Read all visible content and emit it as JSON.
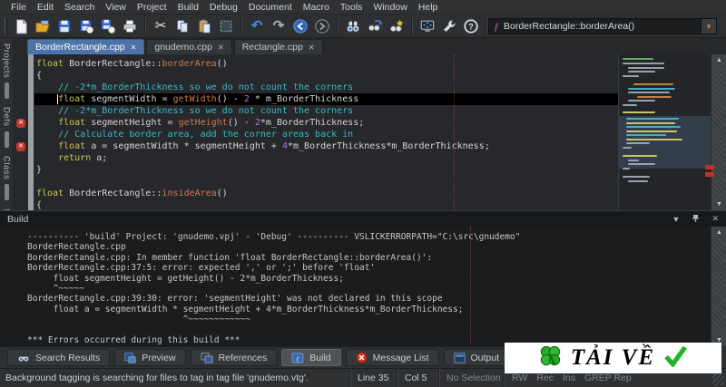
{
  "menu": {
    "items": [
      "File",
      "Edit",
      "Search",
      "View",
      "Project",
      "Build",
      "Debug",
      "Document",
      "Macro",
      "Tools",
      "Window",
      "Help"
    ]
  },
  "toolbar": {
    "symbol_combo_value": "BorderRectangle::borderArea()"
  },
  "editor_tabs": [
    {
      "label": "BorderRectangle.cpp",
      "active": true
    },
    {
      "label": "gnudemo.cpp",
      "active": false
    },
    {
      "label": "Rectangle.cpp",
      "active": false
    }
  ],
  "sidebar": {
    "tabs": [
      "Projects",
      "Defs",
      "Class",
      "Symbols"
    ]
  },
  "editor": {
    "current_line": 3,
    "error_lines": [
      5,
      7
    ],
    "lines": [
      [
        [
          "float ",
          "k"
        ],
        [
          "BorderRectangle::",
          "p"
        ],
        [
          "borderArea",
          "f"
        ],
        [
          "()",
          "p"
        ]
      ],
      [
        [
          "{",
          "p"
        ]
      ],
      [
        [
          "    ",
          "p"
        ],
        [
          "// -2*m_BorderThickness so we do not count the corners",
          "c"
        ]
      ],
      [
        [
          "    ",
          "p"
        ],
        [
          "float",
          "k"
        ],
        [
          " segmentWidth = ",
          "p"
        ],
        [
          "getWidth",
          "f"
        ],
        [
          "() - ",
          "p"
        ],
        [
          "2",
          "n"
        ],
        [
          " * m_BorderThickness",
          "p"
        ]
      ],
      [
        [
          "    ",
          "p"
        ],
        [
          "// -2*m_BorderThickness so we do not count the corners",
          "c"
        ]
      ],
      [
        [
          "    ",
          "p"
        ],
        [
          "float",
          "k"
        ],
        [
          " segmentHeight = ",
          "p"
        ],
        [
          "getHeight",
          "f"
        ],
        [
          "() - ",
          "p"
        ],
        [
          "2",
          "n"
        ],
        [
          "*m_BorderThickness;",
          "p"
        ]
      ],
      [
        [
          "    ",
          "p"
        ],
        [
          "// Calculate border area, add the corner areas back in",
          "c"
        ]
      ],
      [
        [
          "    ",
          "p"
        ],
        [
          "float",
          "k"
        ],
        [
          " a = segmentWidth * segmentHeight + ",
          "p"
        ],
        [
          "4",
          "n"
        ],
        [
          "*m_BorderThickness*m_BorderThickness;",
          "p"
        ]
      ],
      [
        [
          "    ",
          "p"
        ],
        [
          "return",
          "k"
        ],
        [
          " a;",
          "p"
        ]
      ],
      [
        [
          "}",
          "p"
        ]
      ],
      [],
      [
        [
          "float ",
          "k"
        ],
        [
          "BorderRectangle::",
          "p"
        ],
        [
          "insideArea",
          "f"
        ],
        [
          "()",
          "p"
        ]
      ],
      [
        [
          "{",
          "p"
        ]
      ]
    ]
  },
  "build_panel": {
    "title": "Build",
    "lines": [
      "---------- 'build' Project: 'gnudemo.vpj' - 'Debug' ---------- VSLICKERRORPATH=\"C:\\src\\gnudemo\"",
      "BorderRectangle.cpp",
      "BorderRectangle.cpp: In member function 'float BorderRectangle::borderArea()':",
      "BorderRectangle.cpp:37:5: error: expected ',' or ';' before 'float'",
      "     float segmentHeight = getHeight() - 2*m_BorderThickness;",
      "     ^~~~~~",
      "BorderRectangle.cpp:39:30: error: 'segmentHeight' was not declared in this scope",
      "     float a = segmentWidth * segmentHeight + 4*m_BorderThickness*m_BorderThickness;",
      "                              ^~~~~~~~~~~~~",
      "",
      "*** Errors occurred during this build ***"
    ]
  },
  "bottom_tabs": [
    {
      "label": "Search Results",
      "icon": "binoculars",
      "active": false
    },
    {
      "label": "Preview",
      "icon": "preview",
      "active": false
    },
    {
      "label": "References",
      "icon": "references",
      "active": false
    },
    {
      "label": "Build",
      "icon": "build",
      "active": true
    },
    {
      "label": "Message List",
      "icon": "message",
      "active": false
    },
    {
      "label": "Output",
      "icon": "output",
      "active": false
    }
  ],
  "status_bar": {
    "message": "Background tagging is searching for files to tag in tag file 'gnudemo.vtg'.",
    "line": "Line 35",
    "column": "Col 5",
    "selection": "No Selection",
    "modes": [
      "RW",
      "Rec",
      "Ins",
      "GREP Rep"
    ]
  },
  "watermark": {
    "text": "TẢI VỀ",
    "text_color": "#16279c",
    "clover_color": "#2ba62b",
    "check_color": "#25b325"
  },
  "colors": {
    "accent": "#4d74a8",
    "error": "#c0392b",
    "comment": "#3db8c8",
    "keyword": "#c8c457"
  }
}
